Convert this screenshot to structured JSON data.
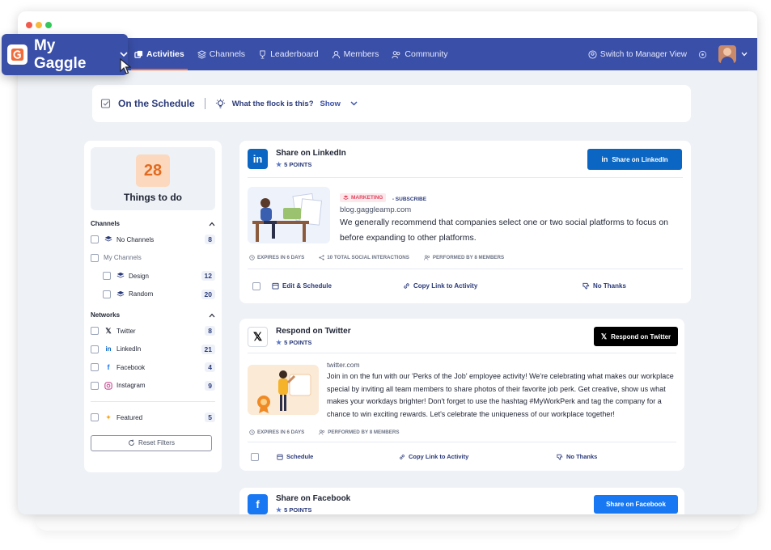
{
  "brand": {
    "name": "My Gaggle",
    "logo_icon": "gaggle-logo-icon"
  },
  "nav": {
    "tabs": [
      {
        "label": "Activities",
        "icon": "activities-icon",
        "active": true
      },
      {
        "label": "Channels",
        "icon": "channels-icon",
        "active": false
      },
      {
        "label": "Leaderboard",
        "icon": "trophy-icon",
        "active": false
      },
      {
        "label": "Members",
        "icon": "user-icon",
        "active": false
      },
      {
        "label": "Community",
        "icon": "users-icon",
        "active": false
      }
    ],
    "switch_label": "Switch to Manager View"
  },
  "schedule_bar": {
    "title": "On the Schedule",
    "flock_question": "What the flock is this?",
    "show_label": "Show"
  },
  "sidebar": {
    "todo_count": "28",
    "todo_label": "Things to do",
    "channels_heading": "Channels",
    "channels": [
      {
        "label": "No Channels",
        "count": "8"
      },
      {
        "label": "My Channels",
        "count": ""
      },
      {
        "label": "Design",
        "count": "12"
      },
      {
        "label": "Random",
        "count": "20"
      }
    ],
    "networks_heading": "Networks",
    "networks": [
      {
        "label": "Twitter",
        "count": "8"
      },
      {
        "label": "LinkedIn",
        "count": "21"
      },
      {
        "label": "Facebook",
        "count": "4"
      },
      {
        "label": "Instagram",
        "count": "9"
      }
    ],
    "featured": {
      "label": "Featured",
      "count": "5"
    },
    "reset_label": "Reset Filters"
  },
  "cards": {
    "linkedin": {
      "title": "Share on LinkedIn",
      "points": "5 POINTS",
      "cta": "Share on LinkedIn",
      "tag": "MARKETING",
      "subscribe": "- SUBSCRIBE",
      "domain": "blog.gaggleamp.com",
      "text": "We generally recommend that companies select one or two social platforms to focus on before expanding to other platforms.",
      "meta": [
        "EXPIRES IN 6 DAYS",
        "10 TOTAL SOCIAL INTERACTIONS",
        "PERFORMED BY 8 MEMBERS"
      ],
      "actions": [
        "Edit & Schedule",
        "Copy Link to Activity",
        "No Thanks"
      ]
    },
    "twitter": {
      "title": "Respond on Twitter",
      "points": "5 POINTS",
      "cta": "Respond on Twitter",
      "domain": "twitter.com",
      "text": "Join in on the fun with our 'Perks of the Job' employee activity! We're celebrating what makes our workplace special by inviting all team members to share photos of their favorite job perk. Get creative, show us what makes your workdays brighter! Don't forget to use the hashtag #MyWorkPerk and tag the company for a chance to win exciting rewards. Let's celebrate the uniqueness of our workplace together!",
      "meta": [
        "EXPIRES IN 6 DAYS",
        "PERFORMED BY 8 MEMBERS"
      ],
      "actions": [
        "Schedule",
        "Copy Link to Activity",
        "No Thanks"
      ]
    },
    "facebook": {
      "title": "Share on Facebook",
      "points": "5 POINTS",
      "cta": "Share on Facebook"
    }
  },
  "colors": {
    "nav": "#3a4fa8",
    "accent": "#f26b3a",
    "linkedin": "#0a66c2",
    "twitter": "#000000",
    "facebook": "#1877f2"
  }
}
